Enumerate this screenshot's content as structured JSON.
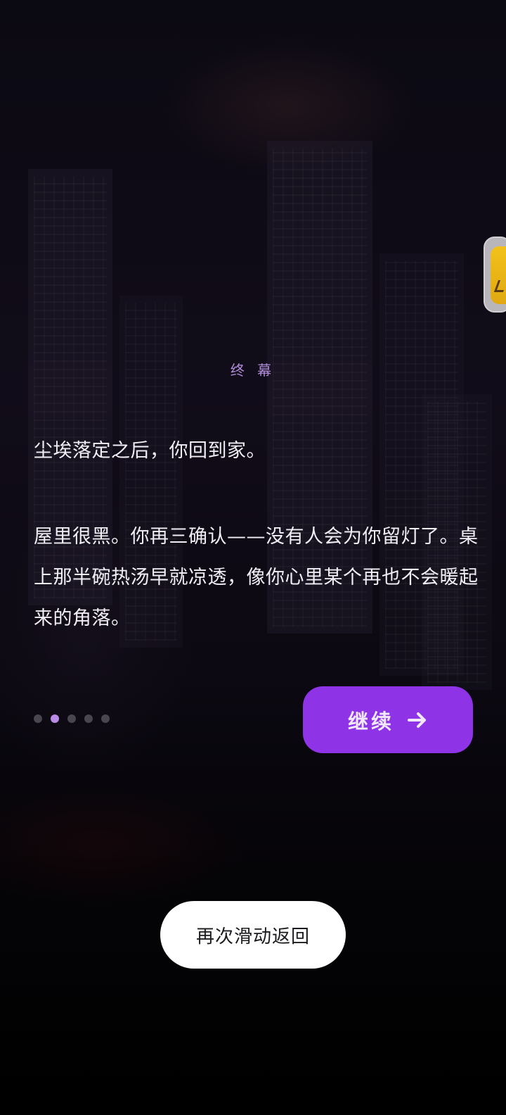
{
  "chapter_title": "终 幕",
  "story": {
    "paragraphs": [
      "尘埃落定之后，你回到家。",
      "屋里很黑。你再三确认——没有人会为你留灯了。桌上那半碗热汤早就凉透，像你心里某个再也不会暖起来的角落。"
    ]
  },
  "pagination": {
    "total": 5,
    "current": 2
  },
  "continue_button": {
    "label": "继续",
    "icon": "arrow-right-icon"
  },
  "system_toast": {
    "text": "再次滑动返回"
  },
  "colors": {
    "accent": "#8e33e6",
    "chapter_text": "#b08cd8",
    "active_dot": "#b98ae6",
    "inactive_dot": "#4a4650",
    "background": "#07050b"
  }
}
